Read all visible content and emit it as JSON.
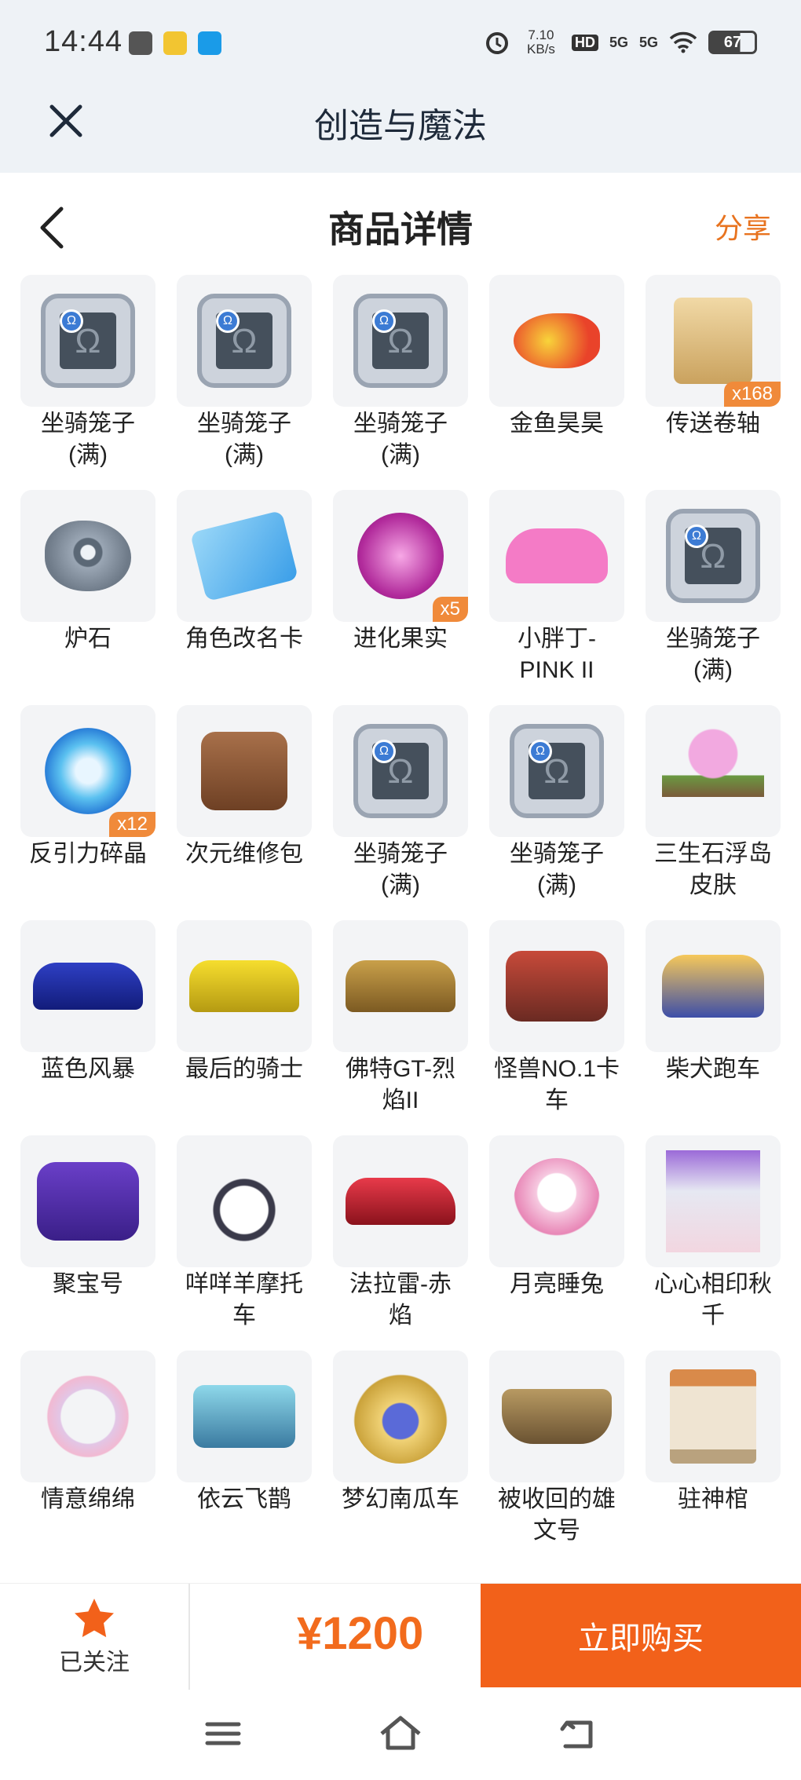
{
  "status": {
    "time": "14:44",
    "net_speed_value": "7.10",
    "net_speed_unit": "KB/s",
    "hd": "HD",
    "signal1": "5G",
    "signal2": "5G",
    "battery": "67"
  },
  "app": {
    "title": "创造与魔法"
  },
  "page": {
    "title": "商品详情",
    "share": "分享"
  },
  "items": [
    {
      "label": "坐骑笼子\n(满)",
      "icon": "cage-icon",
      "badge": ""
    },
    {
      "label": "坐骑笼子\n(满)",
      "icon": "cage-icon",
      "badge": ""
    },
    {
      "label": "坐骑笼子\n(满)",
      "icon": "cage-icon",
      "badge": ""
    },
    {
      "label": "金鱼昊昊",
      "icon": "goldfish-icon",
      "badge": ""
    },
    {
      "label": "传送卷轴",
      "icon": "scroll-icon",
      "badge": "x168"
    },
    {
      "label": "炉石",
      "icon": "hearthstone-icon",
      "badge": ""
    },
    {
      "label": "角色改名卡",
      "icon": "rename-card-icon",
      "badge": ""
    },
    {
      "label": "进化果实",
      "icon": "evolution-fruit-icon",
      "badge": "x5"
    },
    {
      "label": "小胖丁-\nPINK II",
      "icon": "pink-car-icon",
      "badge": ""
    },
    {
      "label": "坐骑笼子\n(满)",
      "icon": "cage-icon",
      "badge": ""
    },
    {
      "label": "反引力碎晶",
      "icon": "crystal-icon",
      "badge": "x12"
    },
    {
      "label": "次元维修包",
      "icon": "repair-bag-icon",
      "badge": ""
    },
    {
      "label": "坐骑笼子\n(满)",
      "icon": "cage-icon",
      "badge": ""
    },
    {
      "label": "坐骑笼子\n(满)",
      "icon": "cage-icon",
      "badge": ""
    },
    {
      "label": "三生石浮岛\n皮肤",
      "icon": "floating-island-icon",
      "badge": ""
    },
    {
      "label": "蓝色风暴",
      "icon": "blue-racecar-icon",
      "badge": ""
    },
    {
      "label": "最后的骑士",
      "icon": "yellow-car-icon",
      "badge": ""
    },
    {
      "label": "佛特GT-烈\n焰II",
      "icon": "gt-car-icon",
      "badge": ""
    },
    {
      "label": "怪兽NO.1卡\n车",
      "icon": "monster-truck-icon",
      "badge": ""
    },
    {
      "label": "柴犬跑车",
      "icon": "shiba-car-icon",
      "badge": ""
    },
    {
      "label": "聚宝号",
      "icon": "treasure-vehicle-icon",
      "badge": ""
    },
    {
      "label": "咩咩羊摩托\n车",
      "icon": "sheep-scooter-icon",
      "badge": ""
    },
    {
      "label": "法拉雷-赤\n焰",
      "icon": "red-sportscar-icon",
      "badge": ""
    },
    {
      "label": "月亮睡兔",
      "icon": "moon-rabbit-icon",
      "badge": ""
    },
    {
      "label": "心心相印秋\n千",
      "icon": "swing-icon",
      "badge": ""
    },
    {
      "label": "情意绵绵",
      "icon": "wreath-icon",
      "badge": ""
    },
    {
      "label": "依云飞鹊",
      "icon": "drone-icon",
      "badge": ""
    },
    {
      "label": "梦幻南瓜车",
      "icon": "pumpkin-carriage-icon",
      "badge": ""
    },
    {
      "label": "被收回的雄\n文号",
      "icon": "ship-icon",
      "badge": ""
    },
    {
      "label": "驻神棺",
      "icon": "shrine-icon",
      "badge": ""
    }
  ],
  "bottom": {
    "follow": "已关注",
    "price": "¥1200",
    "buy": "立即购买"
  },
  "colors": {
    "accent": "#f2611a",
    "price": "#f26b1d",
    "share": "#e8731f",
    "badge": "#f08a3a"
  }
}
